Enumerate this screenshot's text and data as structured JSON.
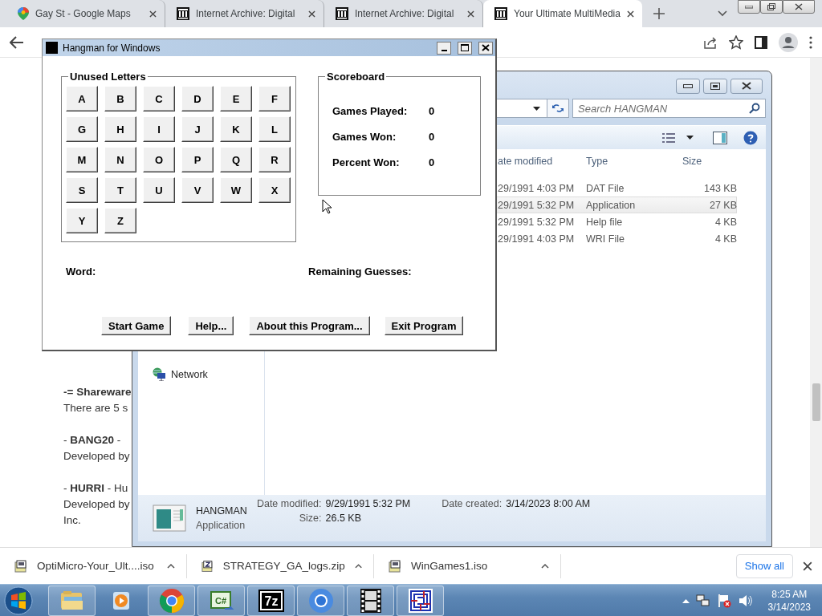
{
  "browser": {
    "tabs": [
      {
        "title": "Gay St - Google Maps",
        "selected": false
      },
      {
        "title": "Internet Archive: Digital",
        "selected": false
      },
      {
        "title": "Internet Archive: Digital",
        "selected": false
      },
      {
        "title": "Your Ultimate MultiMedia",
        "selected": true
      }
    ]
  },
  "page": {
    "paragraphs": [
      [
        {
          "kind": "heading",
          "text": "-= Shareware"
        },
        {
          "kind": "text",
          "text": "There are 5 s"
        }
      ],
      [
        {
          "kind": "text",
          "text": "- **BANG20** -"
        },
        {
          "kind": "text",
          "text": "Developed by"
        }
      ],
      [
        {
          "kind": "text",
          "text": "- **HURRI** - Hu"
        },
        {
          "kind": "text",
          "text": "Developed by"
        },
        {
          "kind": "text",
          "text": "Inc."
        }
      ]
    ]
  },
  "explorer": {
    "search": {
      "placeholder": "Search HANGMAN"
    },
    "nav": [
      {
        "label": "Network",
        "kind": "network"
      }
    ],
    "columns": [
      "ate modified",
      "Type",
      "Size"
    ],
    "files": [
      {
        "date_modified": "29/1991 4:03 PM",
        "type": "DAT File",
        "size": "143 KB",
        "selected": false
      },
      {
        "date_modified": "29/1991 5:32 PM",
        "type": "Application",
        "size": "27 KB",
        "selected": true
      },
      {
        "date_modified": "29/1991 5:32 PM",
        "type": "Help file",
        "size": "4 KB",
        "selected": false
      },
      {
        "date_modified": "29/1991 4:03 PM",
        "type": "WRI File",
        "size": "4 KB",
        "selected": false
      }
    ],
    "details": {
      "name": "HANGMAN",
      "type": "Application",
      "fields": [
        {
          "label": "Date modified:",
          "value": "9/29/1991 5:32 PM"
        },
        {
          "label": "Size:",
          "value": "26.5 KB"
        },
        {
          "label": "Date created:",
          "value": "3/14/2023 8:00 AM"
        }
      ]
    }
  },
  "hangman": {
    "title": "Hangman for Windows",
    "letters_title": "Unused Letters",
    "letters": [
      "A",
      "B",
      "C",
      "D",
      "E",
      "F",
      "G",
      "H",
      "I",
      "J",
      "K",
      "L",
      "M",
      "N",
      "O",
      "P",
      "Q",
      "R",
      "S",
      "T",
      "U",
      "V",
      "W",
      "X",
      "Y",
      "Z"
    ],
    "scoreboard": {
      "title": "Scoreboard",
      "rows": [
        {
          "label": "Games Played:",
          "value": "0"
        },
        {
          "label": "Games Won:",
          "value": "0"
        },
        {
          "label": "Percent Won:",
          "value": "0"
        }
      ]
    },
    "word_label": "Word:",
    "guesses_label": "Remaining Guesses:",
    "buttons": [
      "Start Game",
      "Help...",
      "About this Program...",
      "Exit Program"
    ]
  },
  "downloads": {
    "items": [
      {
        "name": "OptiMicro-Your_Ult....iso",
        "kind": "iso"
      },
      {
        "name": "STRATEGY_GA_logs.zip",
        "kind": "zip"
      },
      {
        "name": "WinGames1.iso",
        "kind": "iso"
      }
    ],
    "show_all": "Show all"
  },
  "taskbar": {
    "apps": [
      {
        "kind": "explorer"
      },
      {
        "kind": "media"
      },
      {
        "kind": "chrome"
      },
      {
        "kind": "csharp",
        "label": "C#"
      },
      {
        "kind": "sevenzip",
        "label": "7z"
      },
      {
        "kind": "chromium"
      },
      {
        "kind": "film"
      },
      {
        "kind": "maze"
      }
    ],
    "time": "8:25 AM",
    "date": "3/14/2023"
  }
}
